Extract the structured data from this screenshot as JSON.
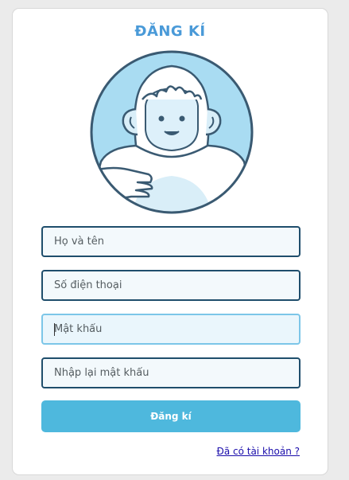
{
  "form": {
    "title": "ĐĂNG KÍ",
    "fullname_placeholder": "Họ và tên",
    "phone_placeholder": "Số điện thoại",
    "password_placeholder": "Mật khẩu",
    "confirm_password_placeholder": "Nhập lại mật khẩu",
    "submit_label": "Đăng kí",
    "login_link": "Đã có tài khoản ?"
  },
  "avatar": {
    "icon": "yeti-mascot-icon"
  },
  "colors": {
    "title": "#4a9ad8",
    "field_border": "#1f4e6c",
    "field_focus_border": "#7cc6e8",
    "button": "#4eb8dd",
    "link": "#1a0dab"
  }
}
